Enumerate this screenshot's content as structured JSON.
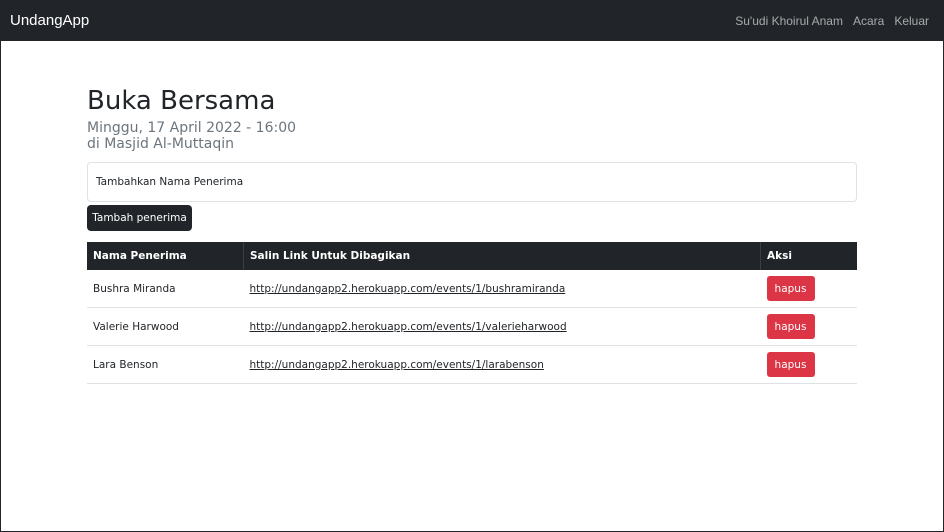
{
  "navbar": {
    "brand": "UndangApp",
    "links": [
      "Su'udi Khoirul Anam",
      "Acara",
      "Keluar"
    ]
  },
  "event": {
    "title": "Buka Bersama",
    "date": "Minggu, 17 April 2022 - 16:00",
    "place": "di Masjid Al-Muttaqin"
  },
  "form": {
    "input_placeholder": "Tambahkan Nama Penerima",
    "add_button": "Tambah penerima"
  },
  "table": {
    "headers": [
      "Nama Penerima",
      "Salin Link Untuk Dibagikan",
      "Aksi"
    ],
    "rows": [
      {
        "name": "Bushra Miranda",
        "link": "http://undangapp2.herokuapp.com/events/1/bushramiranda",
        "action": "hapus"
      },
      {
        "name": "Valerie Harwood",
        "link": "http://undangapp2.herokuapp.com/events/1/valerieharwood",
        "action": "hapus"
      },
      {
        "name": "Lara Benson",
        "link": "http://undangapp2.herokuapp.com/events/1/larabenson",
        "action": "hapus"
      }
    ]
  },
  "colors": {
    "navbar_bg": "#212529",
    "danger": "#dc3545",
    "muted_text": "#6c757d"
  }
}
